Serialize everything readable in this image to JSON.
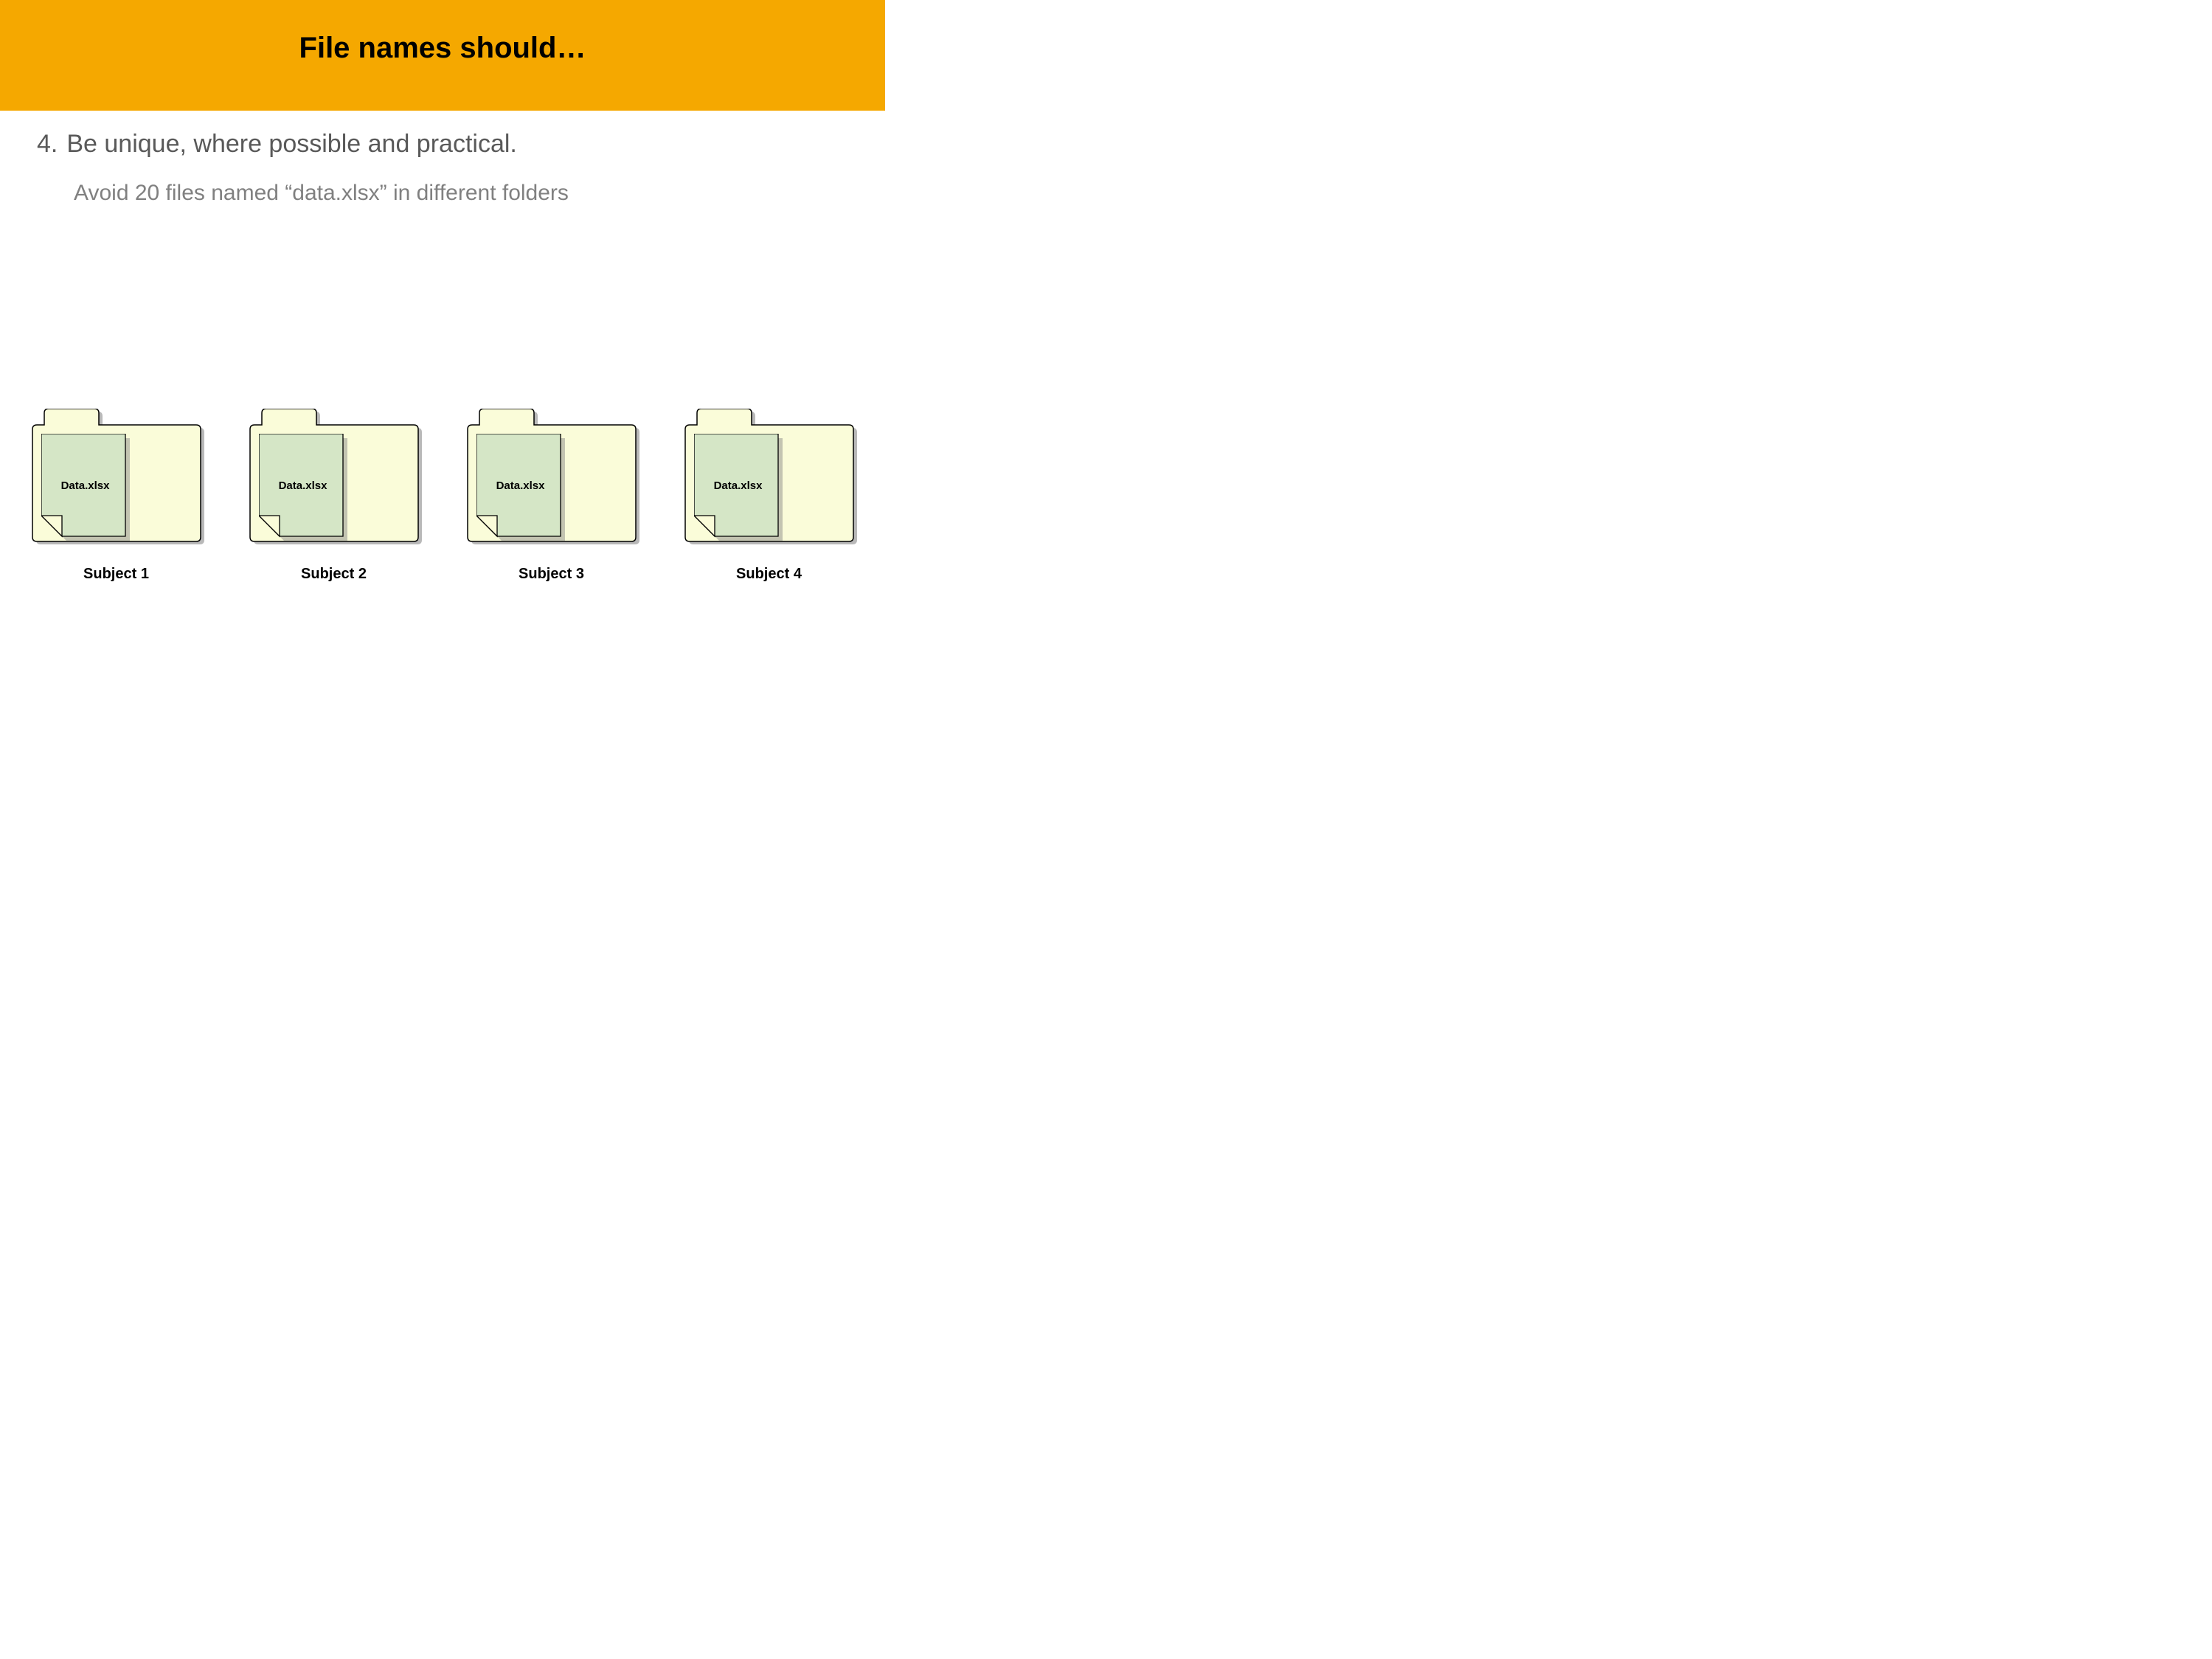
{
  "header": {
    "title": "File names should…"
  },
  "bullet": {
    "number": "4.",
    "text": "Be unique, where possible and practical."
  },
  "subtext": "Avoid 20 files named “data.xlsx” in different folders",
  "folders": [
    {
      "file_label": "Data.xlsx",
      "caption": "Subject 1"
    },
    {
      "file_label": "Data.xlsx",
      "caption": "Subject 2"
    },
    {
      "file_label": "Data.xlsx",
      "caption": "Subject 3"
    },
    {
      "file_label": "Data.xlsx",
      "caption": "Subject 4"
    }
  ]
}
